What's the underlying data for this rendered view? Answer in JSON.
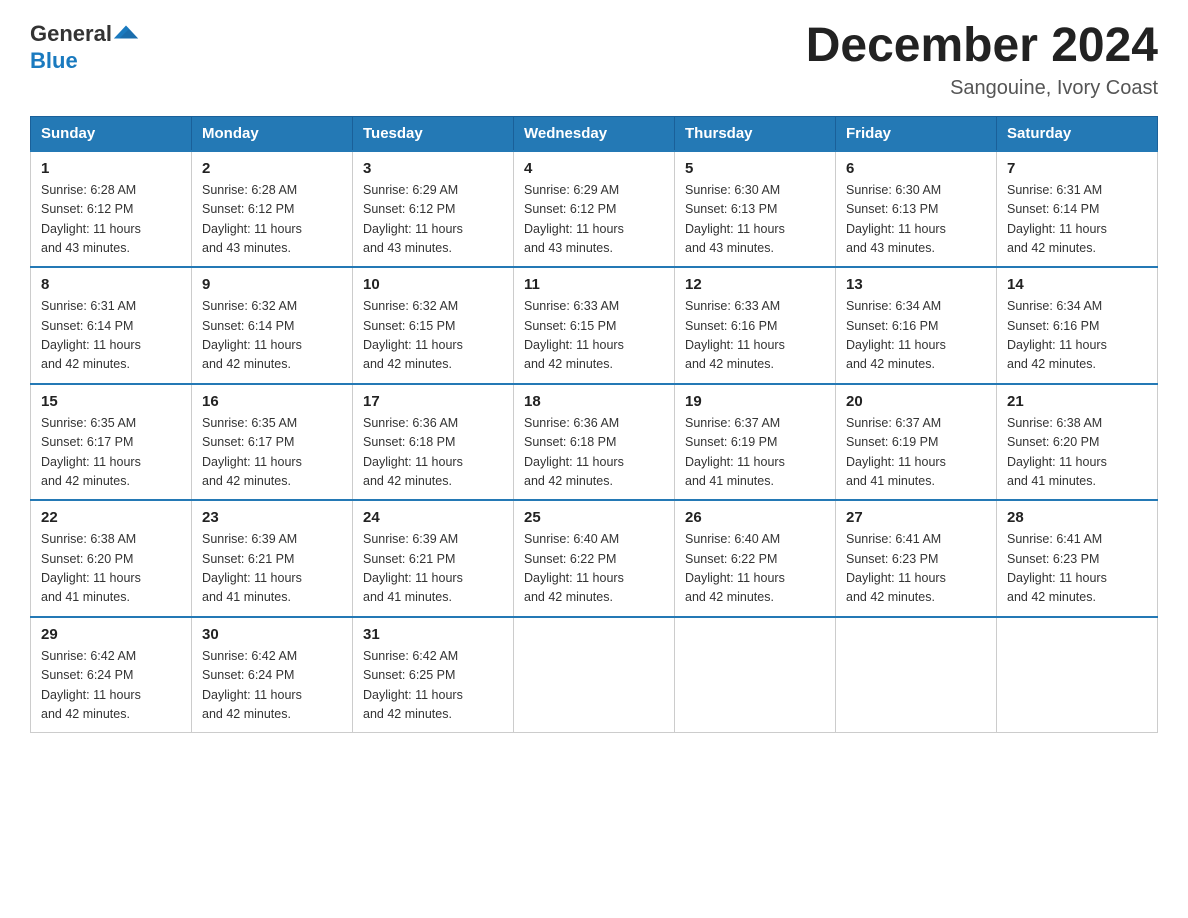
{
  "header": {
    "logo": {
      "general": "General",
      "blue": "Blue"
    },
    "title": "December 2024",
    "location": "Sangouine, Ivory Coast"
  },
  "weekdays": [
    "Sunday",
    "Monday",
    "Tuesday",
    "Wednesday",
    "Thursday",
    "Friday",
    "Saturday"
  ],
  "weeks": [
    [
      {
        "day": "1",
        "sunrise": "6:28 AM",
        "sunset": "6:12 PM",
        "daylight": "11 hours and 43 minutes."
      },
      {
        "day": "2",
        "sunrise": "6:28 AM",
        "sunset": "6:12 PM",
        "daylight": "11 hours and 43 minutes."
      },
      {
        "day": "3",
        "sunrise": "6:29 AM",
        "sunset": "6:12 PM",
        "daylight": "11 hours and 43 minutes."
      },
      {
        "day": "4",
        "sunrise": "6:29 AM",
        "sunset": "6:12 PM",
        "daylight": "11 hours and 43 minutes."
      },
      {
        "day": "5",
        "sunrise": "6:30 AM",
        "sunset": "6:13 PM",
        "daylight": "11 hours and 43 minutes."
      },
      {
        "day": "6",
        "sunrise": "6:30 AM",
        "sunset": "6:13 PM",
        "daylight": "11 hours and 43 minutes."
      },
      {
        "day": "7",
        "sunrise": "6:31 AM",
        "sunset": "6:14 PM",
        "daylight": "11 hours and 42 minutes."
      }
    ],
    [
      {
        "day": "8",
        "sunrise": "6:31 AM",
        "sunset": "6:14 PM",
        "daylight": "11 hours and 42 minutes."
      },
      {
        "day": "9",
        "sunrise": "6:32 AM",
        "sunset": "6:14 PM",
        "daylight": "11 hours and 42 minutes."
      },
      {
        "day": "10",
        "sunrise": "6:32 AM",
        "sunset": "6:15 PM",
        "daylight": "11 hours and 42 minutes."
      },
      {
        "day": "11",
        "sunrise": "6:33 AM",
        "sunset": "6:15 PM",
        "daylight": "11 hours and 42 minutes."
      },
      {
        "day": "12",
        "sunrise": "6:33 AM",
        "sunset": "6:16 PM",
        "daylight": "11 hours and 42 minutes."
      },
      {
        "day": "13",
        "sunrise": "6:34 AM",
        "sunset": "6:16 PM",
        "daylight": "11 hours and 42 minutes."
      },
      {
        "day": "14",
        "sunrise": "6:34 AM",
        "sunset": "6:16 PM",
        "daylight": "11 hours and 42 minutes."
      }
    ],
    [
      {
        "day": "15",
        "sunrise": "6:35 AM",
        "sunset": "6:17 PM",
        "daylight": "11 hours and 42 minutes."
      },
      {
        "day": "16",
        "sunrise": "6:35 AM",
        "sunset": "6:17 PM",
        "daylight": "11 hours and 42 minutes."
      },
      {
        "day": "17",
        "sunrise": "6:36 AM",
        "sunset": "6:18 PM",
        "daylight": "11 hours and 42 minutes."
      },
      {
        "day": "18",
        "sunrise": "6:36 AM",
        "sunset": "6:18 PM",
        "daylight": "11 hours and 42 minutes."
      },
      {
        "day": "19",
        "sunrise": "6:37 AM",
        "sunset": "6:19 PM",
        "daylight": "11 hours and 41 minutes."
      },
      {
        "day": "20",
        "sunrise": "6:37 AM",
        "sunset": "6:19 PM",
        "daylight": "11 hours and 41 minutes."
      },
      {
        "day": "21",
        "sunrise": "6:38 AM",
        "sunset": "6:20 PM",
        "daylight": "11 hours and 41 minutes."
      }
    ],
    [
      {
        "day": "22",
        "sunrise": "6:38 AM",
        "sunset": "6:20 PM",
        "daylight": "11 hours and 41 minutes."
      },
      {
        "day": "23",
        "sunrise": "6:39 AM",
        "sunset": "6:21 PM",
        "daylight": "11 hours and 41 minutes."
      },
      {
        "day": "24",
        "sunrise": "6:39 AM",
        "sunset": "6:21 PM",
        "daylight": "11 hours and 41 minutes."
      },
      {
        "day": "25",
        "sunrise": "6:40 AM",
        "sunset": "6:22 PM",
        "daylight": "11 hours and 42 minutes."
      },
      {
        "day": "26",
        "sunrise": "6:40 AM",
        "sunset": "6:22 PM",
        "daylight": "11 hours and 42 minutes."
      },
      {
        "day": "27",
        "sunrise": "6:41 AM",
        "sunset": "6:23 PM",
        "daylight": "11 hours and 42 minutes."
      },
      {
        "day": "28",
        "sunrise": "6:41 AM",
        "sunset": "6:23 PM",
        "daylight": "11 hours and 42 minutes."
      }
    ],
    [
      {
        "day": "29",
        "sunrise": "6:42 AM",
        "sunset": "6:24 PM",
        "daylight": "11 hours and 42 minutes."
      },
      {
        "day": "30",
        "sunrise": "6:42 AM",
        "sunset": "6:24 PM",
        "daylight": "11 hours and 42 minutes."
      },
      {
        "day": "31",
        "sunrise": "6:42 AM",
        "sunset": "6:25 PM",
        "daylight": "11 hours and 42 minutes."
      },
      null,
      null,
      null,
      null
    ]
  ],
  "labels": {
    "sunrise": "Sunrise:",
    "sunset": "Sunset:",
    "daylight": "Daylight:"
  }
}
